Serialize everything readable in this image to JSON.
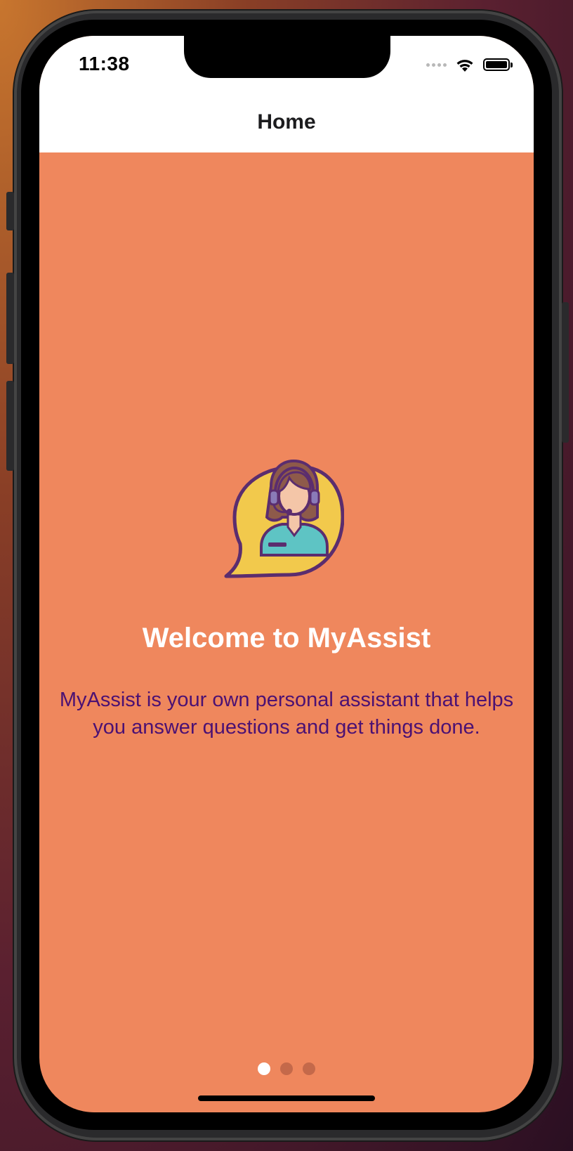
{
  "status_bar": {
    "time": "11:38",
    "wifi_icon": "wifi-icon",
    "battery_icon": "battery-icon"
  },
  "nav": {
    "title": "Home"
  },
  "onboarding": {
    "illustration_icon": "support-agent-icon",
    "title": "Welcome to MyAssist",
    "description": "MyAssist is your own personal assistant that helps you answer questions and get things done.",
    "page_count": 3,
    "current_page": 1
  },
  "colors": {
    "background": "#ef875d",
    "title_text": "#ffffff",
    "description_text": "#4b1173",
    "nav_bar": "#ffffff"
  }
}
